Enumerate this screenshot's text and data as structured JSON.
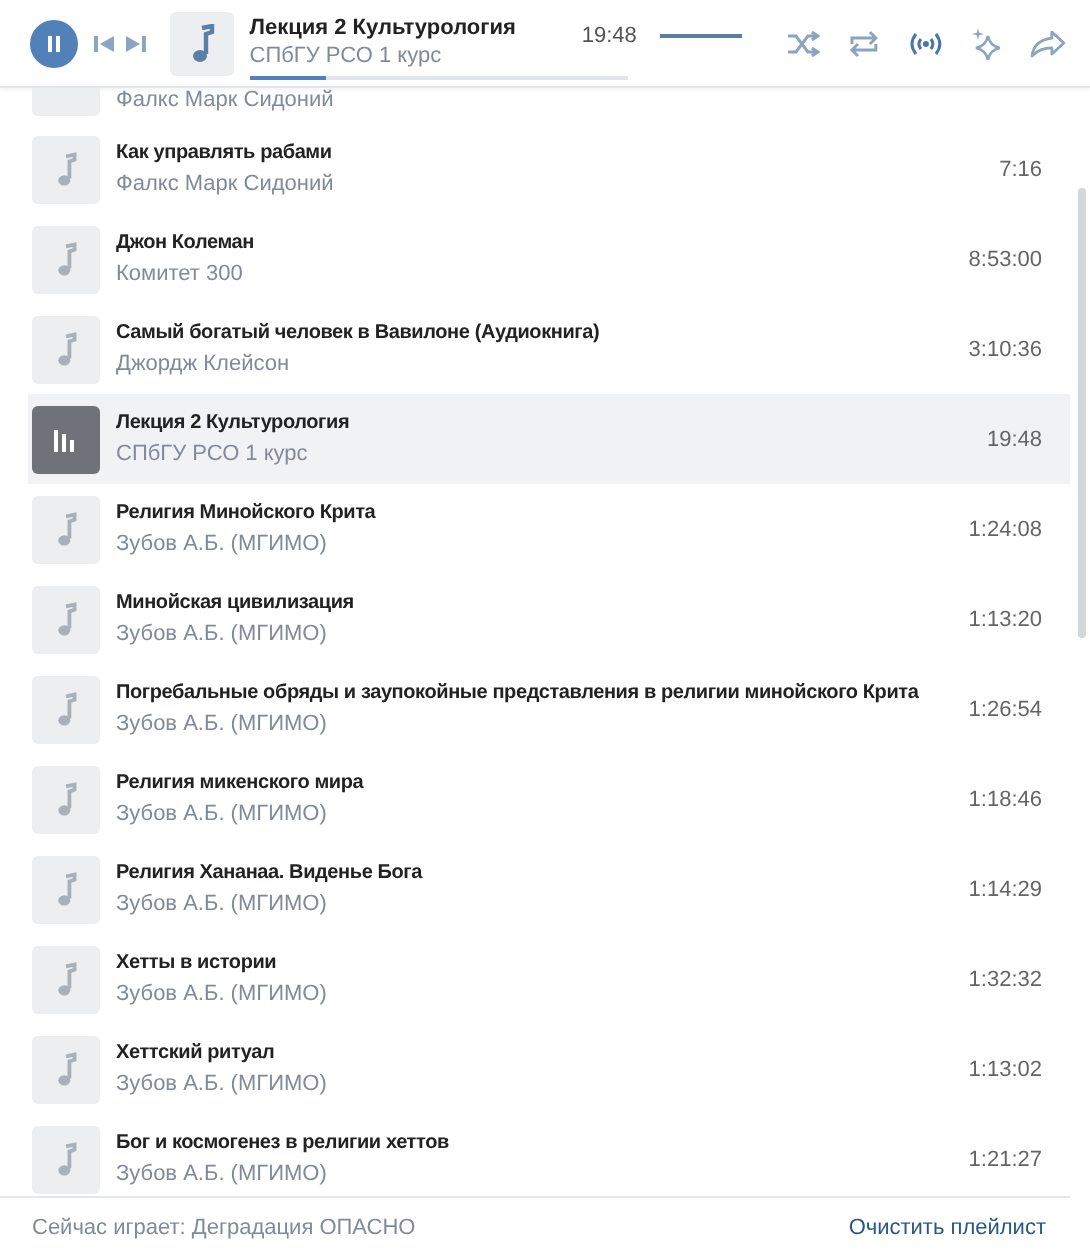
{
  "player": {
    "playing": true,
    "title": "Лекция 2 Культурология",
    "artist": "СПбГУ РСО 1 курс",
    "time": "19:48",
    "progress": {
      "level": 0.2
    },
    "volume": {
      "level": 1
    },
    "broadcast": true
  },
  "partial_row": {
    "artist": "Фалкс Марк Сидоний"
  },
  "tracks": [
    {
      "title": "Как управлять рабами",
      "artist": "Фалкс Марк Сидоний",
      "duration": "7:16",
      "selected": false
    },
    {
      "title": "Джон Колеман",
      "artist": "Комитет 300",
      "duration": "8:53:00",
      "selected": false
    },
    {
      "title": "Самый богатый человек в Вавилоне (Аудиокнига)",
      "artist": "Джордж Клейсон",
      "duration": "3:10:36",
      "selected": false
    },
    {
      "title": "Лекция 2 Культурология",
      "artist": "СПбГУ РСО 1 курс",
      "duration": "19:48",
      "selected": true
    },
    {
      "title": "Религия Минойского Крита",
      "artist": "Зубов А.Б. (МГИМО)",
      "duration": "1:24:08",
      "selected": false
    },
    {
      "title": "Минойская цивилизация",
      "artist": "Зубов А.Б. (МГИМО)",
      "duration": "1:13:20",
      "selected": false
    },
    {
      "title": "Погребальные обряды и заупокойные представления в религии минойского Крита",
      "artist": "Зубов А.Б. (МГИМО)",
      "duration": "1:26:54",
      "selected": false
    },
    {
      "title": "Религия микенского мира",
      "artist": "Зубов А.Б. (МГИМО)",
      "duration": "1:18:46",
      "selected": false
    },
    {
      "title": "Религия Хананаа. Виденье Бога",
      "artist": "Зубов А.Б. (МГИМО)",
      "duration": "1:14:29",
      "selected": false
    },
    {
      "title": "Хетты в истории",
      "artist": "Зубов А.Б. (МГИМО)",
      "duration": "1:32:32",
      "selected": false
    },
    {
      "title": "Хеттский ритуал",
      "artist": "Зубов А.Б. (МГИМО)",
      "duration": "1:13:02",
      "selected": false
    },
    {
      "title": "Бог и космогенез в религии хеттов",
      "artist": "Зубов А.Б. (МГИМО)",
      "duration": "1:21:27",
      "selected": false
    }
  ],
  "footer": {
    "now_playing": "Сейчас играет: Деградация ОПАСНО",
    "clear_link": "Очистить плейлист"
  }
}
